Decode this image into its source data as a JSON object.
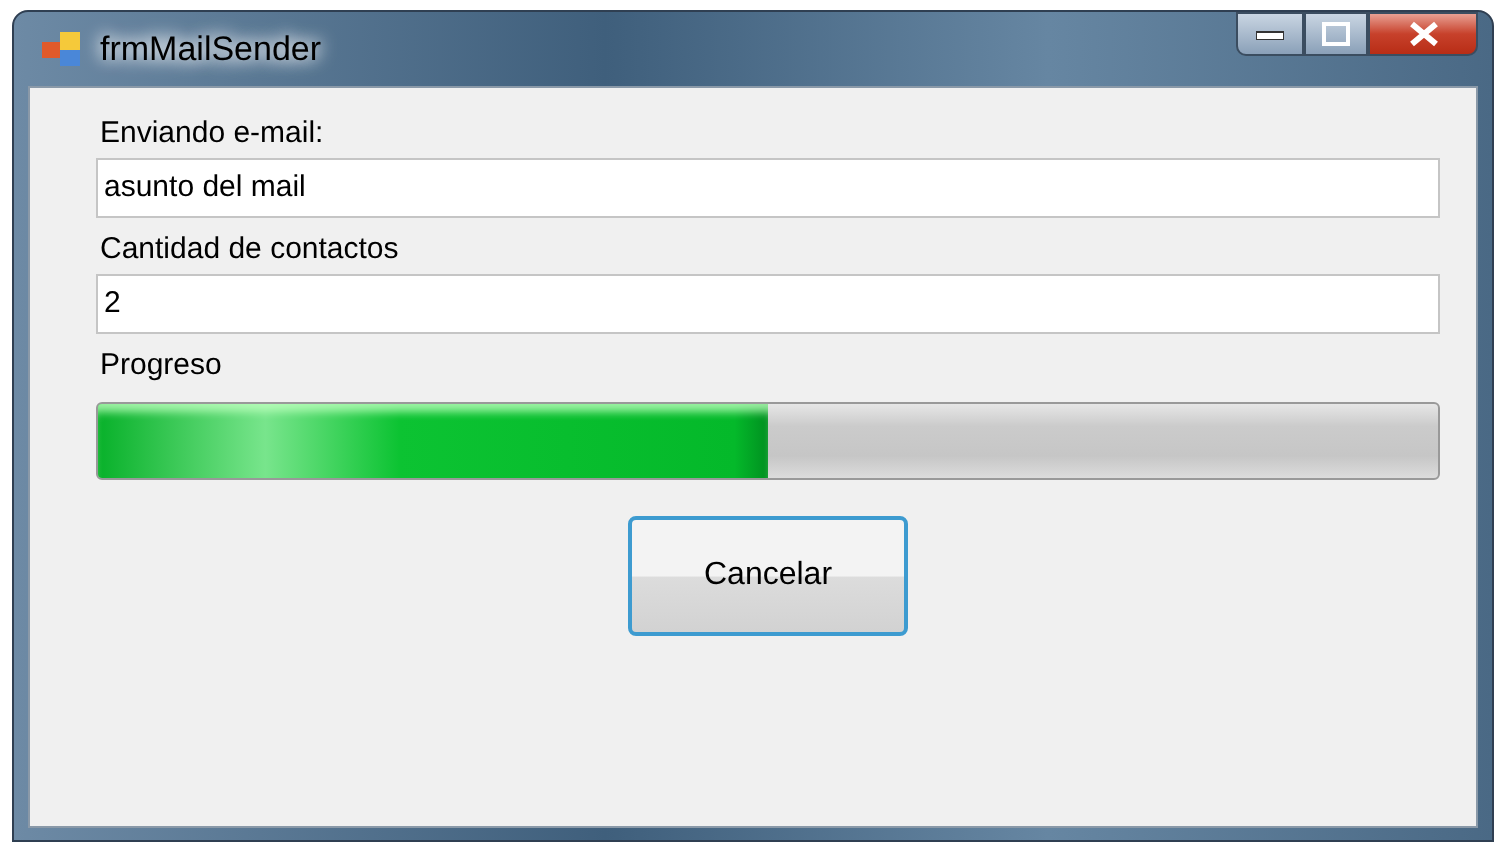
{
  "window": {
    "title": "frmMailSender"
  },
  "fields": [
    {
      "label": "Enviando e-mail:",
      "value": "asunto del mail"
    },
    {
      "label": "Cantidad de contactos",
      "value": "2"
    }
  ],
  "progress": {
    "label": "Progreso",
    "level": 0.5
  },
  "buttons": [
    "Cancelar"
  ]
}
